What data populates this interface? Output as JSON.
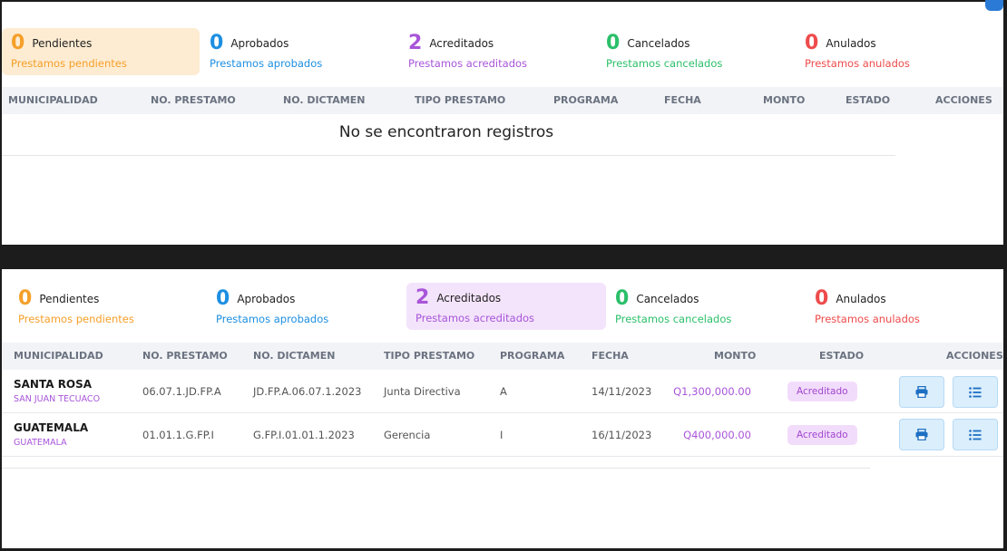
{
  "top": {
    "stats": [
      {
        "count": "0",
        "title": "Pendientes",
        "subtitle": "Prestamos pendientes"
      },
      {
        "count": "0",
        "title": "Aprobados",
        "subtitle": "Prestamos aprobados"
      },
      {
        "count": "2",
        "title": "Acreditados",
        "subtitle": "Prestamos acreditados"
      },
      {
        "count": "0",
        "title": "Cancelados",
        "subtitle": "Prestamos cancelados"
      },
      {
        "count": "0",
        "title": "Anulados",
        "subtitle": "Prestamos anulados"
      }
    ],
    "columns": [
      "MUNICIPALIDAD",
      "NO. PRESTAMO",
      "NO. DICTAMEN",
      "TIPO PRESTAMO",
      "PROGRAMA",
      "FECHA",
      "MONTO",
      "ESTADO",
      "ACCIONES"
    ],
    "empty_message": "No se encontraron registros"
  },
  "bottom": {
    "stats": [
      {
        "count": "0",
        "title": "Pendientes",
        "subtitle": "Prestamos pendientes"
      },
      {
        "count": "0",
        "title": "Aprobados",
        "subtitle": "Prestamos aprobados"
      },
      {
        "count": "2",
        "title": "Acreditados",
        "subtitle": "Prestamos acreditados"
      },
      {
        "count": "0",
        "title": "Cancelados",
        "subtitle": "Prestamos cancelados"
      },
      {
        "count": "0",
        "title": "Anulados",
        "subtitle": "Prestamos anulados"
      }
    ],
    "columns": [
      "MUNICIPALIDAD",
      "NO. PRESTAMO",
      "NO. DICTAMEN",
      "TIPO PRESTAMO",
      "PROGRAMA",
      "FECHA",
      "MONTO",
      "ESTADO",
      "ACCIONES"
    ],
    "rows": [
      {
        "municipalidad": "SANTA ROSA",
        "sub": "SAN JUAN TECUACO",
        "no_prestamo": "06.07.1.JD.FP.A",
        "no_dictamen": "JD.FP.A.06.07.1.2023",
        "tipo": "Junta Directiva",
        "programa": "A",
        "fecha": "14/11/2023",
        "monto": "Q1,300,000.00",
        "estado": "Acreditado"
      },
      {
        "municipalidad": "GUATEMALA",
        "sub": "GUATEMALA",
        "no_prestamo": "01.01.1.G.FP.I",
        "no_dictamen": "G.FP.I.01.01.1.2023",
        "tipo": "Gerencia",
        "programa": "I",
        "fecha": "16/11/2023",
        "monto": "Q400,000.00",
        "estado": "Acreditado"
      }
    ]
  },
  "icons": {
    "print": "printer-icon",
    "list": "list-icon"
  },
  "colors": {
    "pendientes": "#f59f2a",
    "aprobados": "#1d8fe1",
    "acreditados": "#a855d9",
    "cancelados": "#2bbf6a",
    "anulados": "#ee4b4b"
  }
}
